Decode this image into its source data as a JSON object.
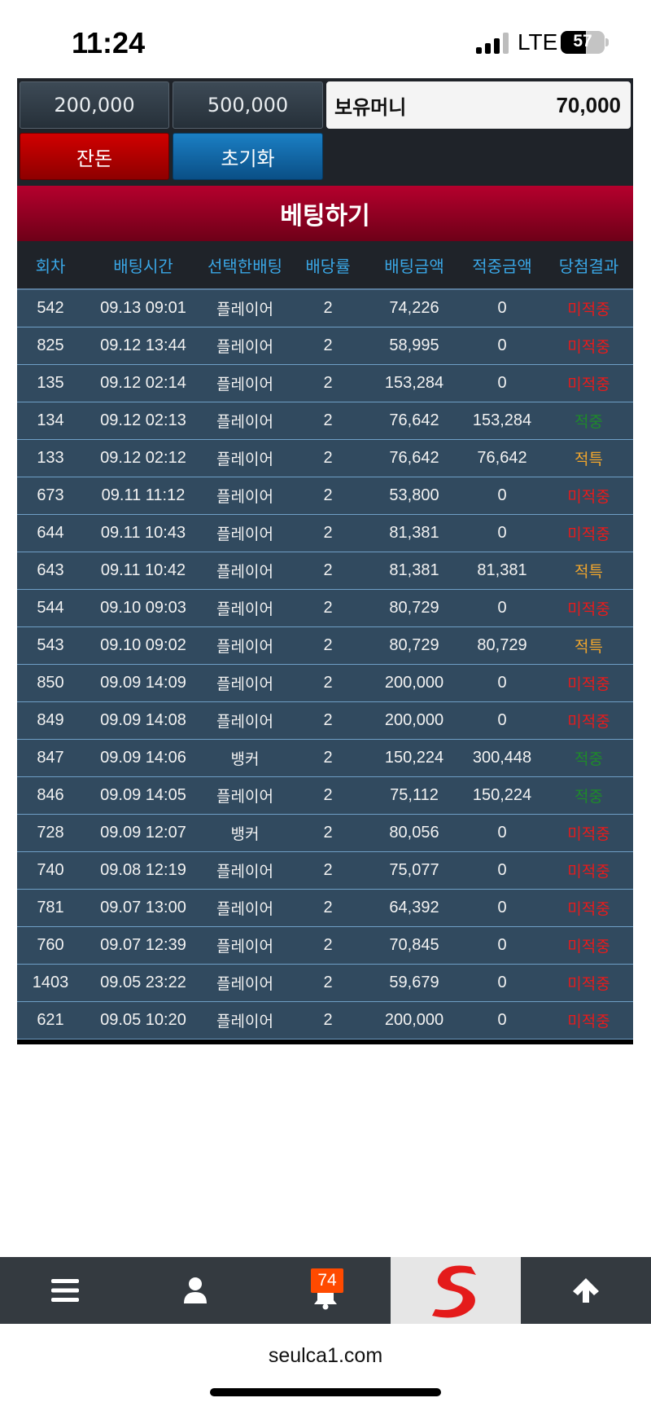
{
  "status": {
    "time": "11:24",
    "network": "LTE",
    "battery": "57"
  },
  "chips": [
    "200,000",
    "500,000"
  ],
  "balance": {
    "label": "보유머니",
    "value": "70,000"
  },
  "actions": {
    "change_label": "잔돈",
    "reset_label": "초기화"
  },
  "bet_button": "베팅하기",
  "table": {
    "headers": [
      "회차",
      "배팅시간",
      "선택한배팅",
      "배당률",
      "배팅금액",
      "적중금액",
      "당첨결과"
    ],
    "rows": [
      {
        "round": "542",
        "time": "09.13 09:01",
        "pick": "플레이어",
        "odds": "2",
        "amount": "74,226",
        "win": "0",
        "result": "미적중",
        "rtype": "miss"
      },
      {
        "round": "825",
        "time": "09.12 13:44",
        "pick": "플레이어",
        "odds": "2",
        "amount": "58,995",
        "win": "0",
        "result": "미적중",
        "rtype": "miss"
      },
      {
        "round": "135",
        "time": "09.12 02:14",
        "pick": "플레이어",
        "odds": "2",
        "amount": "153,284",
        "win": "0",
        "result": "미적중",
        "rtype": "miss"
      },
      {
        "round": "134",
        "time": "09.12 02:13",
        "pick": "플레이어",
        "odds": "2",
        "amount": "76,642",
        "win": "153,284",
        "result": "적중",
        "rtype": "hit"
      },
      {
        "round": "133",
        "time": "09.12 02:12",
        "pick": "플레이어",
        "odds": "2",
        "amount": "76,642",
        "win": "76,642",
        "result": "적특",
        "rtype": "jt"
      },
      {
        "round": "673",
        "time": "09.11 11:12",
        "pick": "플레이어",
        "odds": "2",
        "amount": "53,800",
        "win": "0",
        "result": "미적중",
        "rtype": "miss"
      },
      {
        "round": "644",
        "time": "09.11 10:43",
        "pick": "플레이어",
        "odds": "2",
        "amount": "81,381",
        "win": "0",
        "result": "미적중",
        "rtype": "miss"
      },
      {
        "round": "643",
        "time": "09.11 10:42",
        "pick": "플레이어",
        "odds": "2",
        "amount": "81,381",
        "win": "81,381",
        "result": "적특",
        "rtype": "jt"
      },
      {
        "round": "544",
        "time": "09.10 09:03",
        "pick": "플레이어",
        "odds": "2",
        "amount": "80,729",
        "win": "0",
        "result": "미적중",
        "rtype": "miss"
      },
      {
        "round": "543",
        "time": "09.10 09:02",
        "pick": "플레이어",
        "odds": "2",
        "amount": "80,729",
        "win": "80,729",
        "result": "적특",
        "rtype": "jt"
      },
      {
        "round": "850",
        "time": "09.09 14:09",
        "pick": "플레이어",
        "odds": "2",
        "amount": "200,000",
        "win": "0",
        "result": "미적중",
        "rtype": "miss"
      },
      {
        "round": "849",
        "time": "09.09 14:08",
        "pick": "플레이어",
        "odds": "2",
        "amount": "200,000",
        "win": "0",
        "result": "미적중",
        "rtype": "miss"
      },
      {
        "round": "847",
        "time": "09.09 14:06",
        "pick": "뱅커",
        "odds": "2",
        "amount": "150,224",
        "win": "300,448",
        "result": "적중",
        "rtype": "hit"
      },
      {
        "round": "846",
        "time": "09.09 14:05",
        "pick": "플레이어",
        "odds": "2",
        "amount": "75,112",
        "win": "150,224",
        "result": "적중",
        "rtype": "hit"
      },
      {
        "round": "728",
        "time": "09.09 12:07",
        "pick": "뱅커",
        "odds": "2",
        "amount": "80,056",
        "win": "0",
        "result": "미적중",
        "rtype": "miss"
      },
      {
        "round": "740",
        "time": "09.08 12:19",
        "pick": "플레이어",
        "odds": "2",
        "amount": "75,077",
        "win": "0",
        "result": "미적중",
        "rtype": "miss"
      },
      {
        "round": "781",
        "time": "09.07 13:00",
        "pick": "플레이어",
        "odds": "2",
        "amount": "64,392",
        "win": "0",
        "result": "미적중",
        "rtype": "miss"
      },
      {
        "round": "760",
        "time": "09.07 12:39",
        "pick": "플레이어",
        "odds": "2",
        "amount": "70,845",
        "win": "0",
        "result": "미적중",
        "rtype": "miss"
      },
      {
        "round": "1403",
        "time": "09.05 23:22",
        "pick": "플레이어",
        "odds": "2",
        "amount": "59,679",
        "win": "0",
        "result": "미적중",
        "rtype": "miss"
      },
      {
        "round": "621",
        "time": "09.05 10:20",
        "pick": "플레이어",
        "odds": "2",
        "amount": "200,000",
        "win": "0",
        "result": "미적중",
        "rtype": "miss"
      }
    ]
  },
  "nav": {
    "notification_count": "74",
    "items": [
      "menu-icon",
      "user-icon",
      "bell-icon",
      "logo",
      "arrow-up-icon"
    ]
  },
  "url": "seulca1.com",
  "colors": {
    "miss": "#e81b1b",
    "hit": "#1e8a2a",
    "special": "#f0a52c",
    "header_text": "#3aa7e6",
    "row_bg": "#314a5f"
  }
}
